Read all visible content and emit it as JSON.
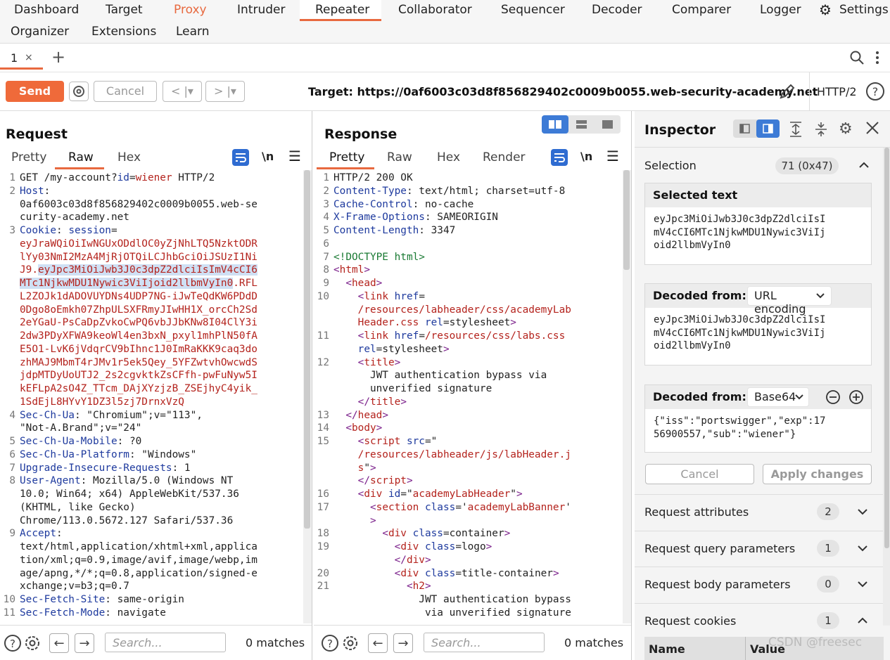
{
  "nav": {
    "row1": [
      "Dashboard",
      "Target",
      "Proxy",
      "Intruder",
      "Repeater",
      "Collaborator",
      "Sequencer",
      "Decoder",
      "Comparer",
      "Logger",
      "Settings"
    ],
    "row2": [
      "Organizer",
      "Extensions",
      "Learn"
    ]
  },
  "tabs": {
    "tab1_label": "1",
    "tab1_close": "×",
    "add": "+"
  },
  "toolbar": {
    "send": "Send",
    "cancel": "Cancel",
    "target": "Target: https://0af6003c03d8f856829402c0009b0055.web-security-academy.net",
    "protocol": "HTTP/2"
  },
  "request": {
    "title": "Request",
    "tabs": [
      "Pretty",
      "Raw",
      "Hex"
    ],
    "newline": "\\n",
    "lines": [
      {
        "n": "1",
        "parts": [
          [
            "",
            "GET /my-account?"
          ],
          [
            "k",
            "id"
          ],
          [
            "",
            "="
          ],
          [
            "r",
            "wiener"
          ],
          [
            "",
            " HTTP/2"
          ]
        ]
      },
      {
        "n": "2",
        "parts": [
          [
            "k",
            "Host"
          ],
          [
            "",
            ":"
          ]
        ]
      },
      {
        "n": "",
        "parts": [
          [
            "",
            "0af6003c03d8f856829402c0009b0055.web-se"
          ]
        ]
      },
      {
        "n": "",
        "parts": [
          [
            "",
            "curity-academy.net"
          ]
        ]
      },
      {
        "n": "3",
        "parts": [
          [
            "k",
            "Cookie"
          ],
          [
            "",
            ": "
          ],
          [
            "k",
            "session"
          ],
          [
            "",
            "="
          ]
        ]
      },
      {
        "n": "",
        "parts": [
          [
            "r",
            "eyJraWQiOiIwNGUxODdlOC0yZjNhLTQ5NzktODR"
          ]
        ]
      },
      {
        "n": "",
        "parts": [
          [
            "r",
            "lYy03NmI2MzA4MjRjOTQiLCJhbGciOiJSUzI1Ni"
          ]
        ]
      },
      {
        "n": "",
        "parts": [
          [
            "r",
            "J9."
          ],
          [
            "rs",
            "eyJpc3MiOiJwb3J0c3dpZ2dlciIsImV4cCI6"
          ]
        ]
      },
      {
        "n": "",
        "parts": [
          [
            "rs",
            "MTc1NjkwMDU1Nywic3ViIjoid2llbmVyIn0"
          ],
          [
            "r",
            ".RFL"
          ]
        ]
      },
      {
        "n": "",
        "parts": [
          [
            "r",
            "L2ZOJk1dADOVUYDNs4UDP7NG-iJwTeQdKW6PDdD"
          ]
        ]
      },
      {
        "n": "",
        "parts": [
          [
            "r",
            "0Dgo8oEmkh07ZhpULSXFRmyJIwHH1X_orcCh2Sd"
          ]
        ]
      },
      {
        "n": "",
        "parts": [
          [
            "r",
            "2eYGaU-PsCaDpZvkoCwPQ6vbJJbKNw8I04ClY3i"
          ]
        ]
      },
      {
        "n": "",
        "parts": [
          [
            "r",
            "2dw3PDyXFWA9keoWl4en3bxN_pxyl1mhPlN50fA"
          ]
        ]
      },
      {
        "n": "",
        "parts": [
          [
            "r",
            "E5O1-LvK6jVdqrCV9bIhnc1J0ImRaKKK9caq3do"
          ]
        ]
      },
      {
        "n": "",
        "parts": [
          [
            "r",
            "zhMAJ9MbmT4rJMv1r5ek5Qey_5YFZwtvhOwcwdS"
          ]
        ]
      },
      {
        "n": "",
        "parts": [
          [
            "r",
            "jdpMTDyUoUTJ2_2s2cgvktkZsCFfh-pwFuNyw5I"
          ]
        ]
      },
      {
        "n": "",
        "parts": [
          [
            "r",
            "kEFLpA2sO4Z_TTcm_DAjXYzjzB_ZSEjhyC4yik_"
          ]
        ]
      },
      {
        "n": "",
        "parts": [
          [
            "r",
            "1SdEjL8HYvY1DZ3l5zj7DrnxVzQ"
          ]
        ]
      },
      {
        "n": "4",
        "parts": [
          [
            "k",
            "Sec-Ch-Ua"
          ],
          [
            "",
            ": \"Chromium\";v=\"113\","
          ]
        ]
      },
      {
        "n": "",
        "parts": [
          [
            "",
            "\"Not-A.Brand\";v=\"24\""
          ]
        ]
      },
      {
        "n": "5",
        "parts": [
          [
            "k",
            "Sec-Ch-Ua-Mobile"
          ],
          [
            "",
            ": ?0"
          ]
        ]
      },
      {
        "n": "6",
        "parts": [
          [
            "k",
            "Sec-Ch-Ua-Platform"
          ],
          [
            "",
            ": \"Windows\""
          ]
        ]
      },
      {
        "n": "7",
        "parts": [
          [
            "k",
            "Upgrade-Insecure-Requests"
          ],
          [
            "",
            ": 1"
          ]
        ]
      },
      {
        "n": "8",
        "parts": [
          [
            "k",
            "User-Agent"
          ],
          [
            "",
            ": Mozilla/5.0 (Windows NT"
          ]
        ]
      },
      {
        "n": "",
        "parts": [
          [
            "",
            "10.0; Win64; x64) AppleWebKit/537.36"
          ]
        ]
      },
      {
        "n": "",
        "parts": [
          [
            "",
            "(KHTML, like Gecko)"
          ]
        ]
      },
      {
        "n": "",
        "parts": [
          [
            "",
            "Chrome/113.0.5672.127 Safari/537.36"
          ]
        ]
      },
      {
        "n": "9",
        "parts": [
          [
            "k",
            "Accept"
          ],
          [
            "",
            ":"
          ]
        ]
      },
      {
        "n": "",
        "parts": [
          [
            "",
            "text/html,application/xhtml+xml,applica"
          ]
        ]
      },
      {
        "n": "",
        "parts": [
          [
            "",
            "tion/xml;q=0.9,image/avif,image/webp,im"
          ]
        ]
      },
      {
        "n": "",
        "parts": [
          [
            "",
            "age/apng,*/*;q=0.8,application/signed-e"
          ]
        ]
      },
      {
        "n": "",
        "parts": [
          [
            "",
            "xchange;v=b3;q=0.7"
          ]
        ]
      },
      {
        "n": "10",
        "parts": [
          [
            "k",
            "Sec-Fetch-Site"
          ],
          [
            "",
            ": same-origin"
          ]
        ]
      },
      {
        "n": "11",
        "parts": [
          [
            "k",
            "Sec-Fetch-Mode"
          ],
          [
            "",
            ": navigate"
          ]
        ]
      }
    ]
  },
  "response": {
    "title": "Response",
    "tabs": [
      "Pretty",
      "Raw",
      "Hex",
      "Render"
    ],
    "newline": "\\n",
    "lines": [
      {
        "n": "1",
        "parts": [
          [
            "",
            "HTTP/2 200 OK"
          ]
        ]
      },
      {
        "n": "2",
        "parts": [
          [
            "k",
            "Content-Type"
          ],
          [
            "",
            ": text/html; charset=utf-8"
          ]
        ]
      },
      {
        "n": "3",
        "parts": [
          [
            "k",
            "Cache-Control"
          ],
          [
            "",
            ": no-cache"
          ]
        ]
      },
      {
        "n": "4",
        "parts": [
          [
            "k",
            "X-Frame-Options"
          ],
          [
            "",
            ": SAMEORIGIN"
          ]
        ]
      },
      {
        "n": "5",
        "parts": [
          [
            "k",
            "Content-Length"
          ],
          [
            "",
            ": 3347"
          ]
        ]
      },
      {
        "n": "6",
        "parts": [
          [
            "",
            ""
          ]
        ]
      },
      {
        "n": "7",
        "parts": [
          [
            "g",
            "<!DOCTYPE html>"
          ]
        ]
      },
      {
        "n": "8",
        "parts": [
          [
            "p",
            "<"
          ],
          [
            "r",
            "html"
          ],
          [
            "p",
            ">"
          ]
        ]
      },
      {
        "n": "9",
        "parts": [
          [
            "",
            "  "
          ],
          [
            "p",
            "<"
          ],
          [
            "r",
            "head"
          ],
          [
            "p",
            ">"
          ]
        ]
      },
      {
        "n": "10",
        "parts": [
          [
            "",
            "    "
          ],
          [
            "p",
            "<"
          ],
          [
            "r",
            "link"
          ],
          [
            "",
            " "
          ],
          [
            "k",
            "href"
          ],
          [
            "",
            "="
          ]
        ]
      },
      {
        "n": "",
        "parts": [
          [
            "r",
            "    /resources/labheader/css/academyLab"
          ]
        ]
      },
      {
        "n": "",
        "parts": [
          [
            "r",
            "    Header.css"
          ],
          [
            "",
            " "
          ],
          [
            "k",
            "rel"
          ],
          [
            "",
            "=stylesheet"
          ],
          [
            "p",
            ">"
          ]
        ]
      },
      {
        "n": "11",
        "parts": [
          [
            "",
            "    "
          ],
          [
            "p",
            "<"
          ],
          [
            "r",
            "link"
          ],
          [
            "",
            " "
          ],
          [
            "k",
            "href"
          ],
          [
            "",
            "="
          ],
          [
            "r",
            "/resources/css/labs.css"
          ]
        ]
      },
      {
        "n": "",
        "parts": [
          [
            "",
            "    "
          ],
          [
            "k",
            "rel"
          ],
          [
            "",
            "=stylesheet"
          ],
          [
            "p",
            ">"
          ]
        ]
      },
      {
        "n": "12",
        "parts": [
          [
            "",
            "    "
          ],
          [
            "p",
            "<"
          ],
          [
            "r",
            "title"
          ],
          [
            "p",
            ">"
          ]
        ]
      },
      {
        "n": "",
        "parts": [
          [
            "",
            "      JWT authentication bypass via"
          ]
        ]
      },
      {
        "n": "",
        "parts": [
          [
            "",
            "      unverified signature"
          ]
        ]
      },
      {
        "n": "",
        "parts": [
          [
            "",
            "    "
          ],
          [
            "p",
            "</"
          ],
          [
            "r",
            "title"
          ],
          [
            "p",
            ">"
          ]
        ]
      },
      {
        "n": "13",
        "parts": [
          [
            "",
            "  "
          ],
          [
            "p",
            "</"
          ],
          [
            "r",
            "head"
          ],
          [
            "p",
            ">"
          ]
        ]
      },
      {
        "n": "14",
        "parts": [
          [
            "",
            "  "
          ],
          [
            "p",
            "<"
          ],
          [
            "r",
            "body"
          ],
          [
            "p",
            ">"
          ]
        ]
      },
      {
        "n": "15",
        "parts": [
          [
            "",
            "    "
          ],
          [
            "p",
            "<"
          ],
          [
            "r",
            "script"
          ],
          [
            "",
            " "
          ],
          [
            "k",
            "src"
          ],
          [
            "",
            "=\""
          ]
        ]
      },
      {
        "n": "",
        "parts": [
          [
            "r",
            "    /resources/labheader/js/labHeader.j"
          ]
        ]
      },
      {
        "n": "",
        "parts": [
          [
            "r",
            "    s"
          ],
          [
            "",
            "\""
          ],
          [
            "p",
            ">"
          ]
        ]
      },
      {
        "n": "",
        "parts": [
          [
            "",
            "    "
          ],
          [
            "p",
            "</"
          ],
          [
            "r",
            "script"
          ],
          [
            "p",
            ">"
          ]
        ]
      },
      {
        "n": "16",
        "parts": [
          [
            "",
            "    "
          ],
          [
            "p",
            "<"
          ],
          [
            "r",
            "div"
          ],
          [
            "",
            " "
          ],
          [
            "k",
            "id"
          ],
          [
            "",
            "=\""
          ],
          [
            "r",
            "academyLabHeader"
          ],
          [
            "",
            "\""
          ],
          [
            "p",
            ">"
          ]
        ]
      },
      {
        "n": "17",
        "parts": [
          [
            "",
            "      "
          ],
          [
            "p",
            "<"
          ],
          [
            "r",
            "section"
          ],
          [
            "",
            " "
          ],
          [
            "k",
            "class"
          ],
          [
            "",
            "='"
          ],
          [
            "r",
            "academyLabBanner"
          ],
          [
            "",
            "'"
          ]
        ]
      },
      {
        "n": "",
        "parts": [
          [
            "",
            "      "
          ],
          [
            "p",
            ">"
          ]
        ]
      },
      {
        "n": "18",
        "parts": [
          [
            "",
            "        "
          ],
          [
            "p",
            "<"
          ],
          [
            "r",
            "div"
          ],
          [
            "",
            " "
          ],
          [
            "k",
            "class"
          ],
          [
            "",
            "=container"
          ],
          [
            "p",
            ">"
          ]
        ]
      },
      {
        "n": "19",
        "parts": [
          [
            "",
            "          "
          ],
          [
            "p",
            "<"
          ],
          [
            "r",
            "div"
          ],
          [
            "",
            " "
          ],
          [
            "k",
            "class"
          ],
          [
            "",
            "=logo"
          ],
          [
            "p",
            ">"
          ]
        ]
      },
      {
        "n": "",
        "parts": [
          [
            "",
            "          "
          ],
          [
            "p",
            "</"
          ],
          [
            "r",
            "div"
          ],
          [
            "p",
            ">"
          ]
        ]
      },
      {
        "n": "20",
        "parts": [
          [
            "",
            "          "
          ],
          [
            "p",
            "<"
          ],
          [
            "r",
            "div"
          ],
          [
            "",
            " "
          ],
          [
            "k",
            "class"
          ],
          [
            "",
            "=title-container"
          ],
          [
            "p",
            ">"
          ]
        ]
      },
      {
        "n": "21",
        "parts": [
          [
            "",
            "            "
          ],
          [
            "p",
            "<"
          ],
          [
            "r",
            "h2"
          ],
          [
            "p",
            ">"
          ]
        ]
      },
      {
        "n": "",
        "parts": [
          [
            "",
            "              JWT authentication bypass"
          ]
        ]
      },
      {
        "n": "",
        "parts": [
          [
            "",
            "               via unverified signature"
          ]
        ]
      }
    ]
  },
  "footer": {
    "search_placeholder": "Search...",
    "matches": "0 matches"
  },
  "inspector": {
    "title": "Inspector",
    "selection_label": "Selection",
    "selection_count": "71 (0x47)",
    "selected_text_title": "Selected text",
    "selected_text": "eyJpc3MiOiJwb3J0c3dpZ2dlciIsI\nmV4cCI6MTc1NjkwMDU1Nywic3ViIj\noid2llbmVyIn0",
    "decoded1_title": "Decoded from:",
    "decoded1_select": "URL encoding",
    "decoded1_text": "eyJpc3MiOiJwb3J0c3dpZ2dlciIsI\nmV4cCI6MTc1NjkwMDU1Nywic3ViIj\noid2llbmVyIn0",
    "decoded2_title": "Decoded from:",
    "decoded2_select": "Base64",
    "decoded2_text": "{\"iss\":\"portswigger\",\"exp\":17\n56900557,\"sub\":\"wiener\"}",
    "cancel": "Cancel",
    "apply": "Apply changes",
    "rows": [
      {
        "label": "Request attributes",
        "count": "2",
        "chevron": "down"
      },
      {
        "label": "Request query parameters",
        "count": "1",
        "chevron": "down"
      },
      {
        "label": "Request body parameters",
        "count": "0",
        "chevron": "down"
      },
      {
        "label": "Request cookies",
        "count": "1",
        "chevron": "up"
      }
    ],
    "cookie_cols": [
      "Name",
      "Value"
    ]
  },
  "watermark": "CSDN @freesec",
  "colors": {
    "accent": "#e8693f",
    "send": "#ef6a3a",
    "key": "#1e3a9e",
    "value": "#b4231d",
    "selection": "#cfe0f4",
    "layout_btn": "#3d7bd6"
  }
}
